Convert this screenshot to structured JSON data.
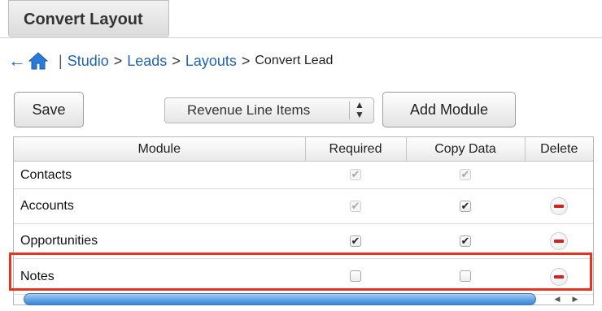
{
  "tab": {
    "label": "Convert Layout"
  },
  "breadcrumb": {
    "separator": "|",
    "gt": ">",
    "items": [
      "Studio",
      "Leads",
      "Layouts"
    ],
    "current": "Convert Lead"
  },
  "toolbar": {
    "save_label": "Save",
    "module_select_value": "Revenue Line Items",
    "add_module_label": "Add Module"
  },
  "table": {
    "headers": [
      "Module",
      "Required",
      "Copy Data",
      "Delete"
    ],
    "rows": [
      {
        "module": "Contacts",
        "required": {
          "checked": true,
          "disabled": true
        },
        "copy_data": {
          "checked": true,
          "disabled": true
        },
        "delete": false
      },
      {
        "module": "Accounts",
        "required": {
          "checked": true,
          "disabled": true
        },
        "copy_data": {
          "checked": true,
          "disabled": false
        },
        "delete": true
      },
      {
        "module": "Opportunities",
        "required": {
          "checked": true,
          "disabled": false
        },
        "copy_data": {
          "checked": true,
          "disabled": false
        },
        "delete": true
      },
      {
        "module": "Notes",
        "required": {
          "checked": false,
          "disabled": false
        },
        "copy_data": {
          "checked": false,
          "disabled": false
        },
        "delete": true
      }
    ]
  },
  "colors": {
    "highlight": "#e8341c",
    "link": "#1e63b5",
    "delete": "#d61f1f"
  }
}
